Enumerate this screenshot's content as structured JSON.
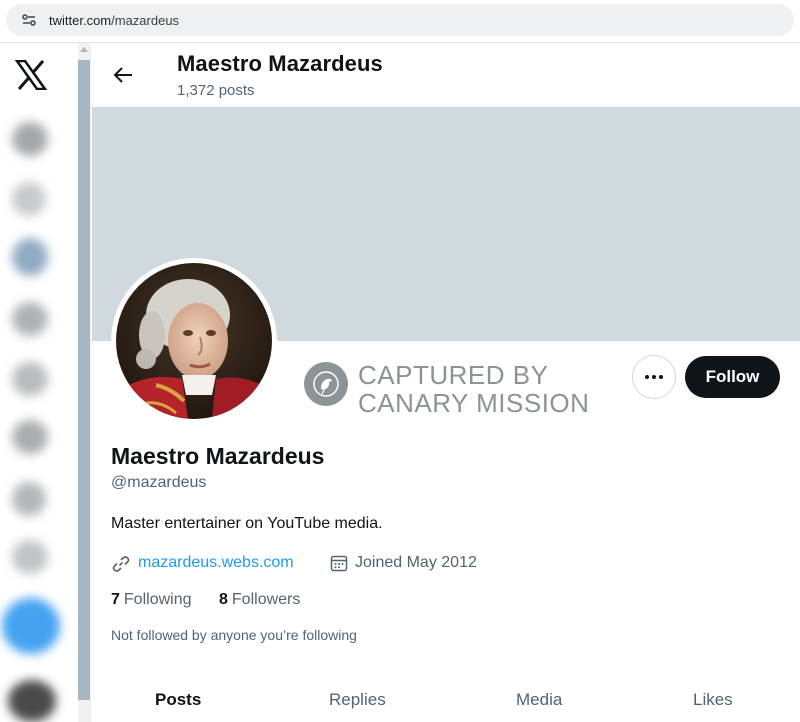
{
  "browser": {
    "url_host": "twitter.com",
    "url_path": "/mazardeus",
    "icon": "site-info-icon"
  },
  "nav": {
    "logo_icon": "x-logo-icon",
    "items": [
      {
        "icon": "home-icon"
      },
      {
        "icon": "search-icon"
      },
      {
        "icon": "notifications-icon"
      },
      {
        "icon": "messages-icon"
      },
      {
        "icon": "lists-icon"
      },
      {
        "icon": "bookmarks-icon"
      },
      {
        "icon": "profile-icon"
      },
      {
        "icon": "more-icon"
      },
      {
        "icon": "post-icon"
      },
      {
        "icon": "account-avatar"
      }
    ]
  },
  "header": {
    "back_icon": "back-arrow-icon",
    "name": "Maestro Mazardeus",
    "posts_count": "1,372 posts"
  },
  "banner": {
    "color": "#cfd9de"
  },
  "watermark": {
    "icon": "canary-bird-icon",
    "line1": "CAPTURED BY",
    "line2": "CANARY MISSION"
  },
  "actions": {
    "more_icon": "more-dots-icon",
    "follow_label": "Follow"
  },
  "profile": {
    "name": "Maestro Mazardeus",
    "handle": "@mazardeus",
    "bio": "Master entertainer on YouTube media.",
    "website": "mazardeus.webs.com",
    "website_icon": "link-icon",
    "joined": "Joined May 2012",
    "joined_icon": "calendar-icon",
    "following_count": "7",
    "following_label": "Following",
    "followers_count": "8",
    "followers_label": "Followers",
    "not_followed": "Not followed by anyone you’re following"
  },
  "tabs": [
    {
      "label": "Posts",
      "active": true
    },
    {
      "label": "Replies",
      "active": false
    },
    {
      "label": "Media",
      "active": false
    },
    {
      "label": "Likes",
      "active": false
    }
  ],
  "colors": {
    "link": "#1d9bf0",
    "secondary_text": "#536471",
    "primary_text": "#0f1419"
  }
}
